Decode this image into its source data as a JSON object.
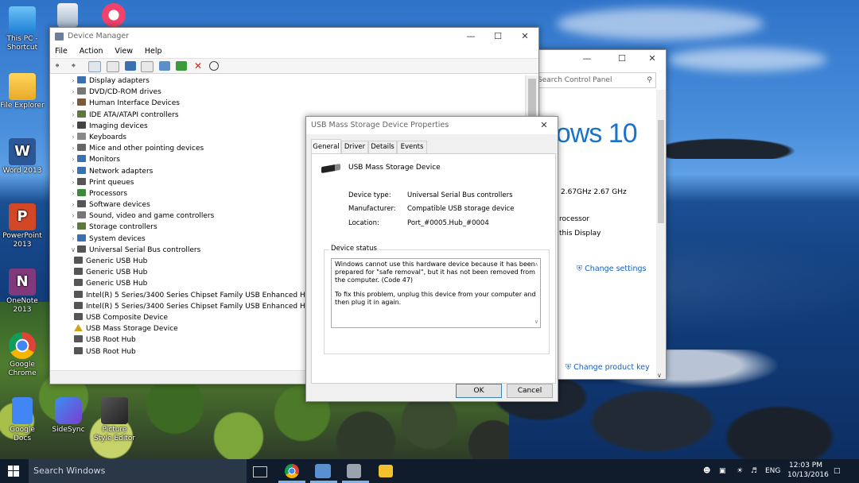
{
  "desktop": {
    "icons": [
      {
        "label": "This PC - Shortcut"
      },
      {
        "label": "File Explorer"
      },
      {
        "label": "Word 2013"
      },
      {
        "label": "PowerPoint 2013"
      },
      {
        "label": "OneNote 2013"
      },
      {
        "label": "Google Chrome"
      },
      {
        "label": "Google Docs"
      },
      {
        "label": "SideSync"
      },
      {
        "label": "Picture Style Editor"
      }
    ]
  },
  "device_manager": {
    "title": "Device Manager",
    "menu": [
      "File",
      "Action",
      "View",
      "Help"
    ],
    "tree": [
      {
        "label": "Display adapters",
        "expander": ">",
        "icon_color": "#3a6fb0"
      },
      {
        "label": "DVD/CD-ROM drives",
        "expander": ">",
        "icon_color": "#777777"
      },
      {
        "label": "Human Interface Devices",
        "expander": ">",
        "icon_color": "#7a5a3a"
      },
      {
        "label": "IDE ATA/ATAPI controllers",
        "expander": ">",
        "icon_color": "#5a7a3a"
      },
      {
        "label": "Imaging devices",
        "expander": ">",
        "icon_color": "#444444"
      },
      {
        "label": "Keyboards",
        "expander": ">",
        "icon_color": "#888888"
      },
      {
        "label": "Mice and other pointing devices",
        "expander": ">",
        "icon_color": "#666666"
      },
      {
        "label": "Monitors",
        "expander": ">",
        "icon_color": "#3a6fb0"
      },
      {
        "label": "Network adapters",
        "expander": ">",
        "icon_color": "#3a6fb0"
      },
      {
        "label": "Print queues",
        "expander": ">",
        "icon_color": "#555555"
      },
      {
        "label": "Processors",
        "expander": ">",
        "icon_color": "#3a8a3a"
      },
      {
        "label": "Software devices",
        "expander": ">",
        "icon_color": "#555555"
      },
      {
        "label": "Sound, video and game controllers",
        "expander": ">",
        "icon_color": "#777777"
      },
      {
        "label": "Storage controllers",
        "expander": ">",
        "icon_color": "#5a7a3a"
      },
      {
        "label": "System devices",
        "expander": ">",
        "icon_color": "#3a6fb0"
      },
      {
        "label": "Universal Serial Bus controllers",
        "expander": "v",
        "icon_color": "#555555"
      },
      {
        "label": "Generic USB Hub",
        "expander": "",
        "icon_color": "#555555",
        "child": true
      },
      {
        "label": "Generic USB Hub",
        "expander": "",
        "icon_color": "#555555",
        "child": true
      },
      {
        "label": "Generic USB Hub",
        "expander": "",
        "icon_color": "#555555",
        "child": true
      },
      {
        "label": "Intel(R) 5 Series/3400 Series Chipset Family USB Enhanced Ho",
        "expander": "",
        "icon_color": "#555555",
        "child": true
      },
      {
        "label": "Intel(R) 5 Series/3400 Series Chipset Family USB Enhanced Ho",
        "expander": "",
        "icon_color": "#555555",
        "child": true
      },
      {
        "label": "USB Composite Device",
        "expander": "",
        "icon_color": "#555555",
        "child": true
      },
      {
        "label": "USB Mass Storage Device",
        "expander": "",
        "icon_color": "#d4a017",
        "child": true,
        "warning": true
      },
      {
        "label": "USB Root Hub",
        "expander": "",
        "icon_color": "#555555",
        "child": true
      },
      {
        "label": "USB Root Hub",
        "expander": "",
        "icon_color": "#555555",
        "child": true
      }
    ]
  },
  "control_panel": {
    "search_placeholder": "Search Control Panel",
    "windows_logo_text": "dows 10",
    "cpu_text": "2.67GHz   2.67 GHz",
    "processor_text": "rocessor",
    "display_text": "this Display",
    "change_settings": "Change settings",
    "change_product_key": "Change product key"
  },
  "dialog": {
    "title": "USB Mass Storage Device Properties",
    "tabs": [
      "General",
      "Driver",
      "Details",
      "Events"
    ],
    "device_name": "USB Mass Storage Device",
    "fields": [
      {
        "key": "Device type:",
        "value": "Universal Serial Bus controllers"
      },
      {
        "key": "Manufacturer:",
        "value": "Compatible USB storage device"
      },
      {
        "key": "Location:",
        "value": "Port_#0005.Hub_#0004"
      }
    ],
    "status_label": "Device status",
    "status_text_1": "Windows cannot use this hardware device because it has been prepared for \"safe removal\", but it has not been removed from the computer. (Code 47)",
    "status_text_2": "To fix this problem, unplug this device from your computer and then plug it in again.",
    "ok_label": "OK",
    "cancel_label": "Cancel"
  },
  "taskbar": {
    "search_placeholder": "Search Windows",
    "language": "ENG",
    "time": "12:03 PM",
    "date": "10/13/2016"
  },
  "colors": {
    "accent": "#1a5fb4",
    "taskbar_bg": "#101c2c",
    "warning": "#d4a017"
  }
}
